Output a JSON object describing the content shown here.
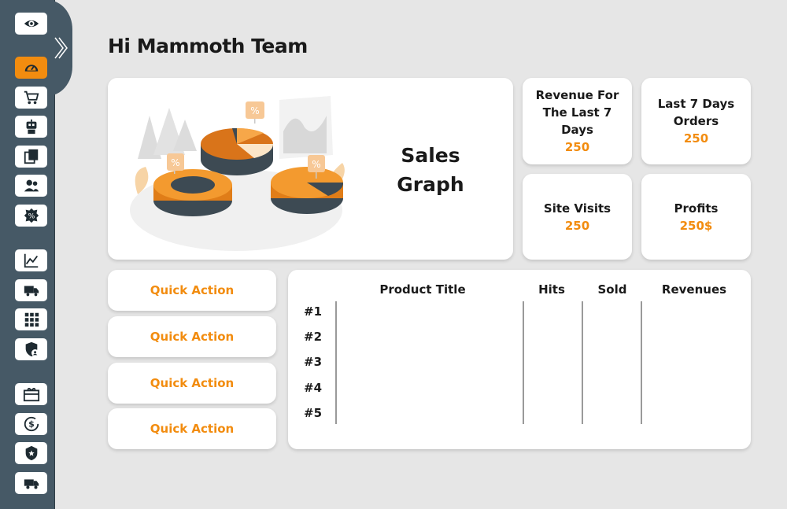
{
  "greeting": "Hi Mammoth Team",
  "sidebar": {
    "expand_icon": "chevron-double-right-icon",
    "items": [
      {
        "icon": "eye-icon",
        "active": false
      },
      {
        "icon": "speedometer-icon",
        "active": true
      },
      {
        "icon": "cart-icon",
        "active": false
      },
      {
        "icon": "robot-icon",
        "active": false
      },
      {
        "icon": "pages-icon",
        "active": false
      },
      {
        "icon": "users-icon",
        "active": false
      },
      {
        "icon": "discount-badge-icon",
        "active": false
      },
      {
        "icon": "line-chart-icon",
        "active": false
      },
      {
        "icon": "truck-icon",
        "active": false
      },
      {
        "icon": "grid-icon",
        "active": false
      },
      {
        "icon": "shield-user-icon",
        "active": false
      },
      {
        "icon": "gift-card-icon",
        "active": false
      },
      {
        "icon": "dollar-refresh-icon",
        "active": false
      },
      {
        "icon": "police-badge-icon",
        "active": false
      },
      {
        "icon": "delivery-truck-icon",
        "active": false
      }
    ]
  },
  "sales_graph": {
    "title_line1": "Sales",
    "title_line2": "Graph",
    "illustration_labels": [
      "%",
      "%",
      "%"
    ]
  },
  "stats": {
    "revenue": {
      "label": "Revenue For The Last 7 Days",
      "value": "250"
    },
    "orders": {
      "label": "Last 7 Days Orders",
      "value": "250"
    },
    "visits": {
      "label": "Site Visits",
      "value": "250"
    },
    "profits": {
      "label": "Profits",
      "value": "250$"
    }
  },
  "quick_actions": [
    "Quick Action",
    "Quick Action",
    "Quick Action",
    "Quick Action"
  ],
  "table": {
    "columns": [
      "Product Title",
      "Hits",
      "Sold",
      "Revenues"
    ],
    "ranks": [
      "#1",
      "#2",
      "#3",
      "#4",
      "#5"
    ]
  },
  "colors": {
    "accent": "#f28c0f",
    "sidebar": "#465966",
    "background": "#e6e6e6"
  }
}
